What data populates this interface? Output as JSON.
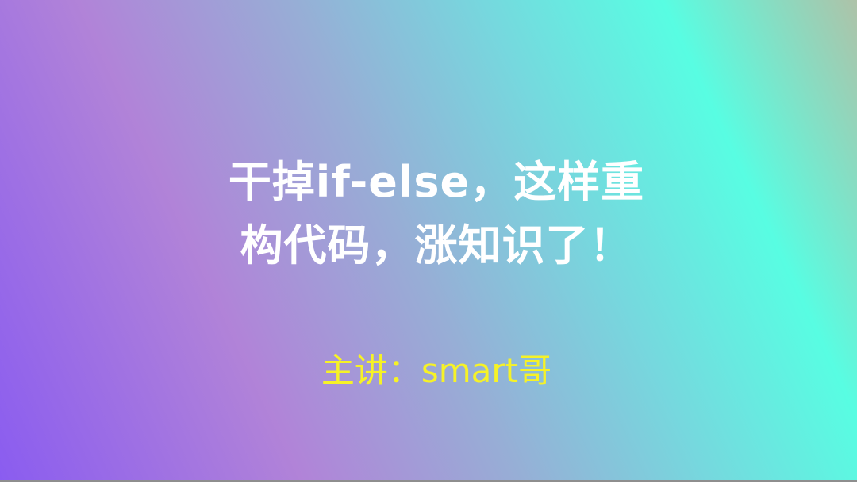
{
  "slide": {
    "title_line_1": "干掉if-else，这样重",
    "title_line_2": "构代码，涨知识了！",
    "presenter": "主讲：smart哥"
  },
  "colors": {
    "title_text": "#ffffff",
    "presenter_text": "#f6f227",
    "gradient_purple": "#8a5cf0",
    "gradient_cyan": "#58fde2"
  }
}
